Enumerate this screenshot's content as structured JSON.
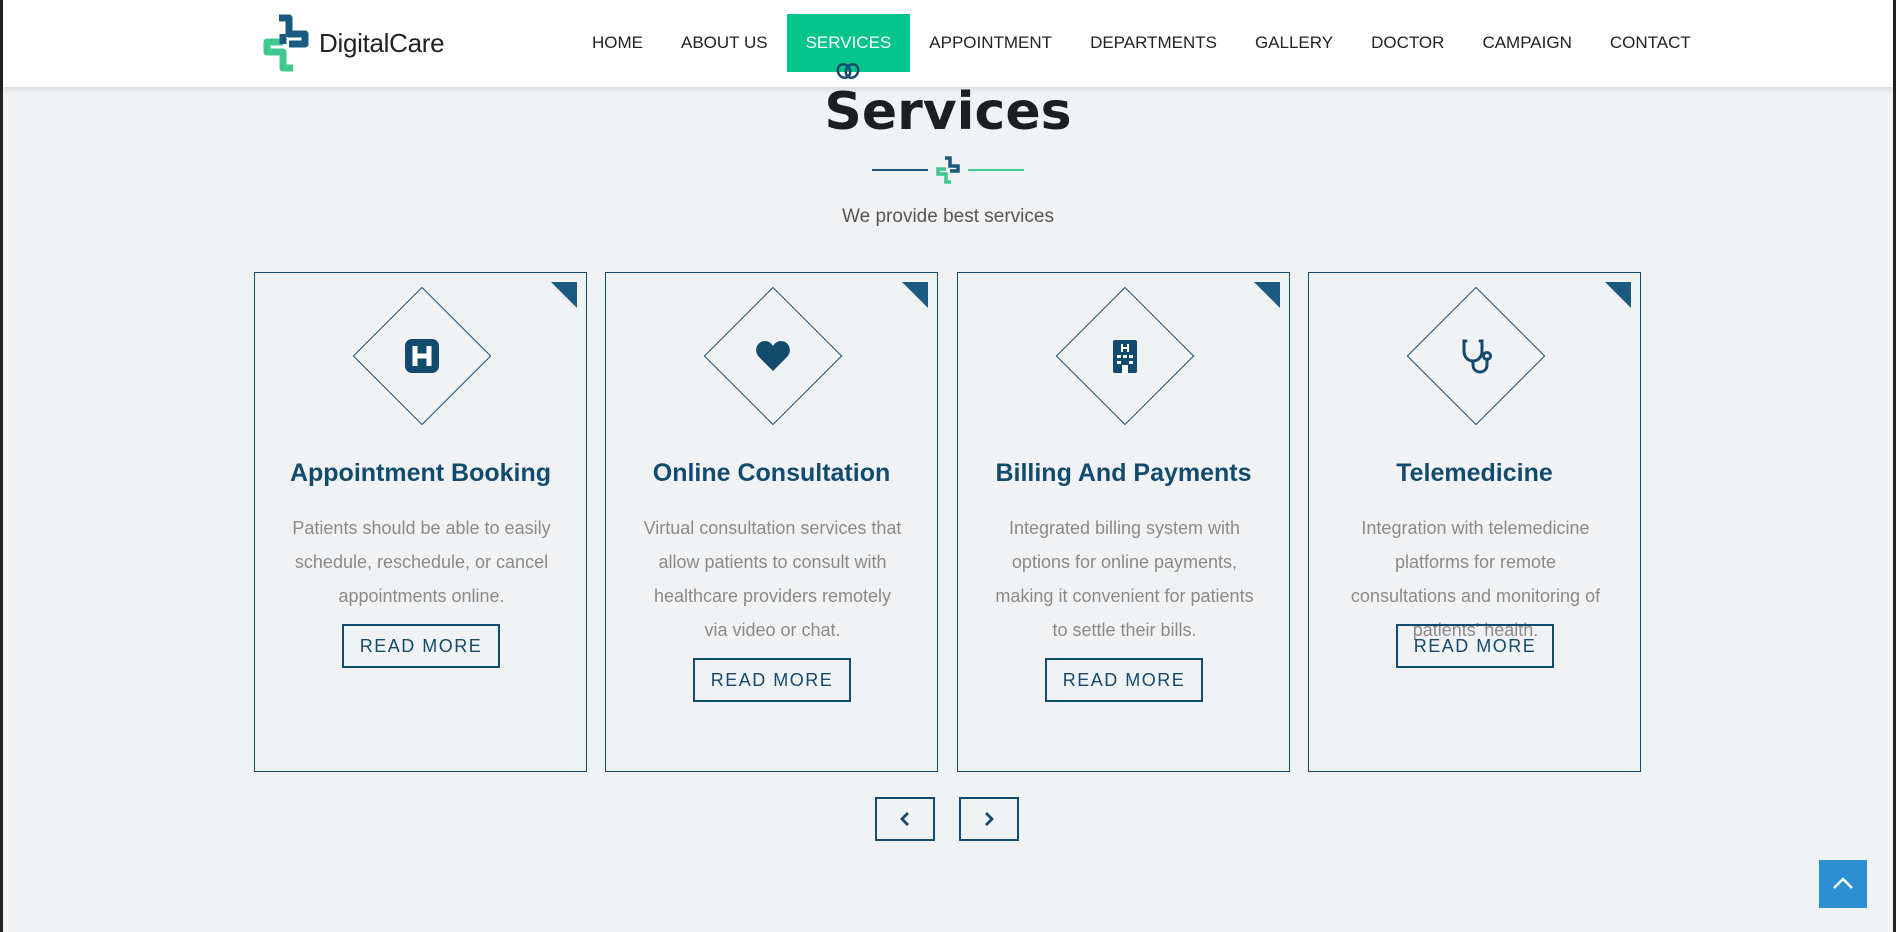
{
  "brand": {
    "name": "DigitalCare",
    "logo_icon": "medical-cross-logo"
  },
  "nav": [
    {
      "label": "HOME",
      "active": false
    },
    {
      "label": "ABOUT US",
      "active": false
    },
    {
      "label": "SERVICES",
      "active": true
    },
    {
      "label": "APPOINTMENT",
      "active": false
    },
    {
      "label": "DEPARTMENTS",
      "active": false
    },
    {
      "label": "GALLERY",
      "active": false
    },
    {
      "label": "DOCTOR",
      "active": false
    },
    {
      "label": "CAMPAIGN",
      "active": false
    },
    {
      "label": "CONTACT",
      "active": false
    }
  ],
  "section": {
    "title": "Services",
    "subtitle": "We provide best services"
  },
  "services": [
    {
      "icon": "hospital-sign-icon",
      "title": "Appointment Booking",
      "description": "Patients should be able to easily schedule, reschedule, or cancel appointments online.",
      "button": "READ MORE"
    },
    {
      "icon": "heart-icon",
      "title": "Online Consultation",
      "description": "Virtual consultation services that allow patients to consult with healthcare providers remotely via video or chat.",
      "button": "READ MORE"
    },
    {
      "icon": "hospital-building-icon",
      "title": "Billing And Payments",
      "description": "Integrated billing system with options for online payments, making it convenient for patients to settle their bills.",
      "button": "READ MORE"
    },
    {
      "icon": "stethoscope-icon",
      "title": "Telemedicine",
      "description": "Integration with telemedicine platforms for remote consultations and monitoring of patients' health.",
      "button": "READ MORE"
    }
  ],
  "colors": {
    "accent_green": "#03c58c",
    "primary_navy": "#134b6e",
    "scroll_top_blue": "#2b8fd1",
    "background": "#f0f2f4"
  }
}
